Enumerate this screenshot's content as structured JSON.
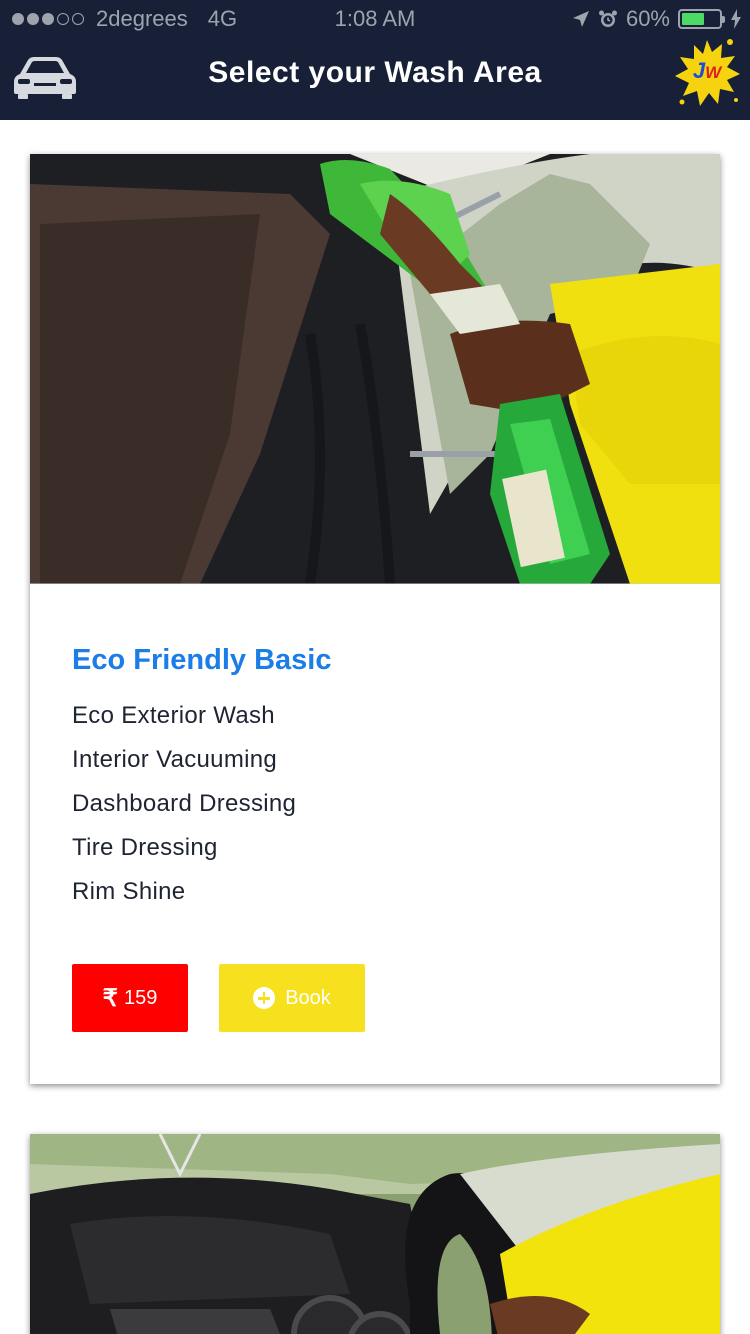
{
  "status_bar": {
    "carrier": "2degrees",
    "network": "4G",
    "time": "1:08 AM",
    "battery": "60%",
    "battery_level": 0.6
  },
  "header": {
    "title": "Select your Wash Area",
    "left_icon": "car-icon",
    "logo_text_j": "J",
    "logo_text_w": "W"
  },
  "packages": [
    {
      "name": "Eco Friendly Basic",
      "features": [
        "Eco Exterior Wash",
        "Interior Vacuuming",
        "Dashboard Dressing",
        "Tire Dressing",
        "Rim Shine"
      ],
      "price_symbol": "₹",
      "price": "159",
      "book_label": "Book"
    }
  ],
  "colors": {
    "header_bg": "#172037",
    "package_title": "#1b7ee6",
    "price_button": "#fe0000",
    "book_button": "#f7e01e"
  }
}
